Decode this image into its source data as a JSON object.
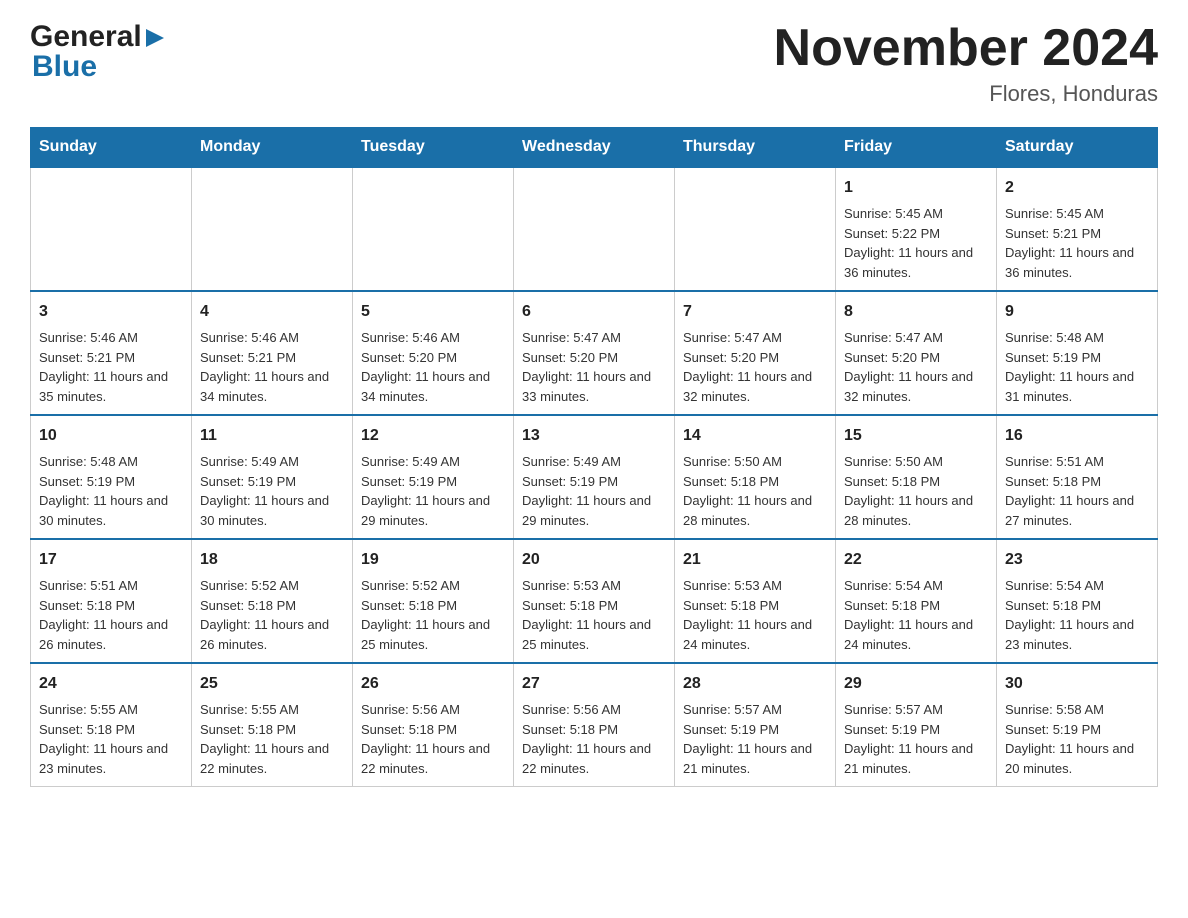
{
  "header": {
    "logo": {
      "general": "General",
      "blue": "Blue",
      "arrow_symbol": "▶"
    },
    "title": "November 2024",
    "location": "Flores, Honduras"
  },
  "days_of_week": [
    "Sunday",
    "Monday",
    "Tuesday",
    "Wednesday",
    "Thursday",
    "Friday",
    "Saturday"
  ],
  "weeks": [
    [
      {
        "day": "",
        "info": ""
      },
      {
        "day": "",
        "info": ""
      },
      {
        "day": "",
        "info": ""
      },
      {
        "day": "",
        "info": ""
      },
      {
        "day": "",
        "info": ""
      },
      {
        "day": "1",
        "info": "Sunrise: 5:45 AM\nSunset: 5:22 PM\nDaylight: 11 hours and 36 minutes."
      },
      {
        "day": "2",
        "info": "Sunrise: 5:45 AM\nSunset: 5:21 PM\nDaylight: 11 hours and 36 minutes."
      }
    ],
    [
      {
        "day": "3",
        "info": "Sunrise: 5:46 AM\nSunset: 5:21 PM\nDaylight: 11 hours and 35 minutes."
      },
      {
        "day": "4",
        "info": "Sunrise: 5:46 AM\nSunset: 5:21 PM\nDaylight: 11 hours and 34 minutes."
      },
      {
        "day": "5",
        "info": "Sunrise: 5:46 AM\nSunset: 5:20 PM\nDaylight: 11 hours and 34 minutes."
      },
      {
        "day": "6",
        "info": "Sunrise: 5:47 AM\nSunset: 5:20 PM\nDaylight: 11 hours and 33 minutes."
      },
      {
        "day": "7",
        "info": "Sunrise: 5:47 AM\nSunset: 5:20 PM\nDaylight: 11 hours and 32 minutes."
      },
      {
        "day": "8",
        "info": "Sunrise: 5:47 AM\nSunset: 5:20 PM\nDaylight: 11 hours and 32 minutes."
      },
      {
        "day": "9",
        "info": "Sunrise: 5:48 AM\nSunset: 5:19 PM\nDaylight: 11 hours and 31 minutes."
      }
    ],
    [
      {
        "day": "10",
        "info": "Sunrise: 5:48 AM\nSunset: 5:19 PM\nDaylight: 11 hours and 30 minutes."
      },
      {
        "day": "11",
        "info": "Sunrise: 5:49 AM\nSunset: 5:19 PM\nDaylight: 11 hours and 30 minutes."
      },
      {
        "day": "12",
        "info": "Sunrise: 5:49 AM\nSunset: 5:19 PM\nDaylight: 11 hours and 29 minutes."
      },
      {
        "day": "13",
        "info": "Sunrise: 5:49 AM\nSunset: 5:19 PM\nDaylight: 11 hours and 29 minutes."
      },
      {
        "day": "14",
        "info": "Sunrise: 5:50 AM\nSunset: 5:18 PM\nDaylight: 11 hours and 28 minutes."
      },
      {
        "day": "15",
        "info": "Sunrise: 5:50 AM\nSunset: 5:18 PM\nDaylight: 11 hours and 28 minutes."
      },
      {
        "day": "16",
        "info": "Sunrise: 5:51 AM\nSunset: 5:18 PM\nDaylight: 11 hours and 27 minutes."
      }
    ],
    [
      {
        "day": "17",
        "info": "Sunrise: 5:51 AM\nSunset: 5:18 PM\nDaylight: 11 hours and 26 minutes."
      },
      {
        "day": "18",
        "info": "Sunrise: 5:52 AM\nSunset: 5:18 PM\nDaylight: 11 hours and 26 minutes."
      },
      {
        "day": "19",
        "info": "Sunrise: 5:52 AM\nSunset: 5:18 PM\nDaylight: 11 hours and 25 minutes."
      },
      {
        "day": "20",
        "info": "Sunrise: 5:53 AM\nSunset: 5:18 PM\nDaylight: 11 hours and 25 minutes."
      },
      {
        "day": "21",
        "info": "Sunrise: 5:53 AM\nSunset: 5:18 PM\nDaylight: 11 hours and 24 minutes."
      },
      {
        "day": "22",
        "info": "Sunrise: 5:54 AM\nSunset: 5:18 PM\nDaylight: 11 hours and 24 minutes."
      },
      {
        "day": "23",
        "info": "Sunrise: 5:54 AM\nSunset: 5:18 PM\nDaylight: 11 hours and 23 minutes."
      }
    ],
    [
      {
        "day": "24",
        "info": "Sunrise: 5:55 AM\nSunset: 5:18 PM\nDaylight: 11 hours and 23 minutes."
      },
      {
        "day": "25",
        "info": "Sunrise: 5:55 AM\nSunset: 5:18 PM\nDaylight: 11 hours and 22 minutes."
      },
      {
        "day": "26",
        "info": "Sunrise: 5:56 AM\nSunset: 5:18 PM\nDaylight: 11 hours and 22 minutes."
      },
      {
        "day": "27",
        "info": "Sunrise: 5:56 AM\nSunset: 5:18 PM\nDaylight: 11 hours and 22 minutes."
      },
      {
        "day": "28",
        "info": "Sunrise: 5:57 AM\nSunset: 5:19 PM\nDaylight: 11 hours and 21 minutes."
      },
      {
        "day": "29",
        "info": "Sunrise: 5:57 AM\nSunset: 5:19 PM\nDaylight: 11 hours and 21 minutes."
      },
      {
        "day": "30",
        "info": "Sunrise: 5:58 AM\nSunset: 5:19 PM\nDaylight: 11 hours and 20 minutes."
      }
    ]
  ],
  "accent_color": "#1a6fa8"
}
